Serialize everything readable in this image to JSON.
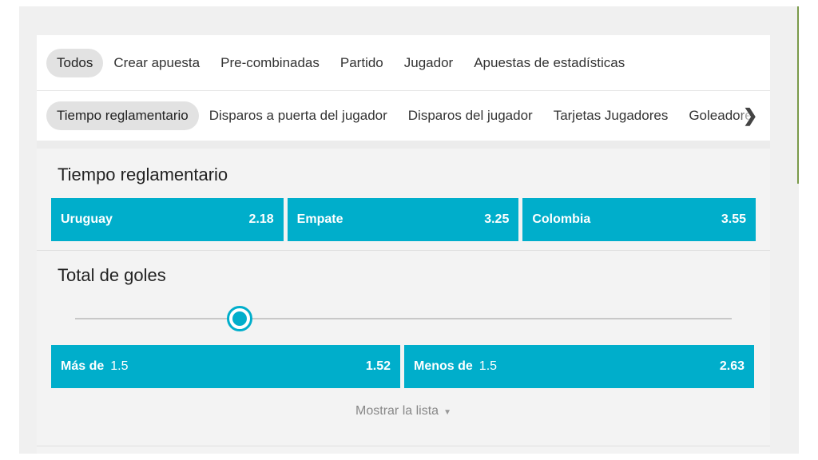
{
  "tabs_primary": [
    "Todos",
    "Crear apuesta",
    "Pre-combinadas",
    "Partido",
    "Jugador",
    "Apuestas de estadísticas"
  ],
  "tabs_secondary": [
    "Tiempo reglamentario",
    "Disparos a puerta del jugador",
    "Disparos del jugador",
    "Tarjetas Jugadores",
    "Goleadores"
  ],
  "market_1": {
    "title": "Tiempo reglamentario",
    "odds": [
      {
        "label": "Uruguay",
        "price": "2.18"
      },
      {
        "label": "Empate",
        "price": "3.25"
      },
      {
        "label": "Colombia",
        "price": "3.55"
      }
    ]
  },
  "market_2": {
    "title": "Total de goles",
    "slider_position_fraction": 0.25,
    "odds": [
      {
        "label": "Más de",
        "line": "1.5",
        "price": "1.52"
      },
      {
        "label": "Menos de",
        "line": "1.5",
        "price": "2.63"
      }
    ],
    "show_list": "Mostrar la lista"
  },
  "icons": {
    "scroll_right": "chevron-right-icon",
    "show_list": "caret-down-icon"
  },
  "colors": {
    "accent": "#00aecb",
    "background": "#f3f3f3"
  }
}
